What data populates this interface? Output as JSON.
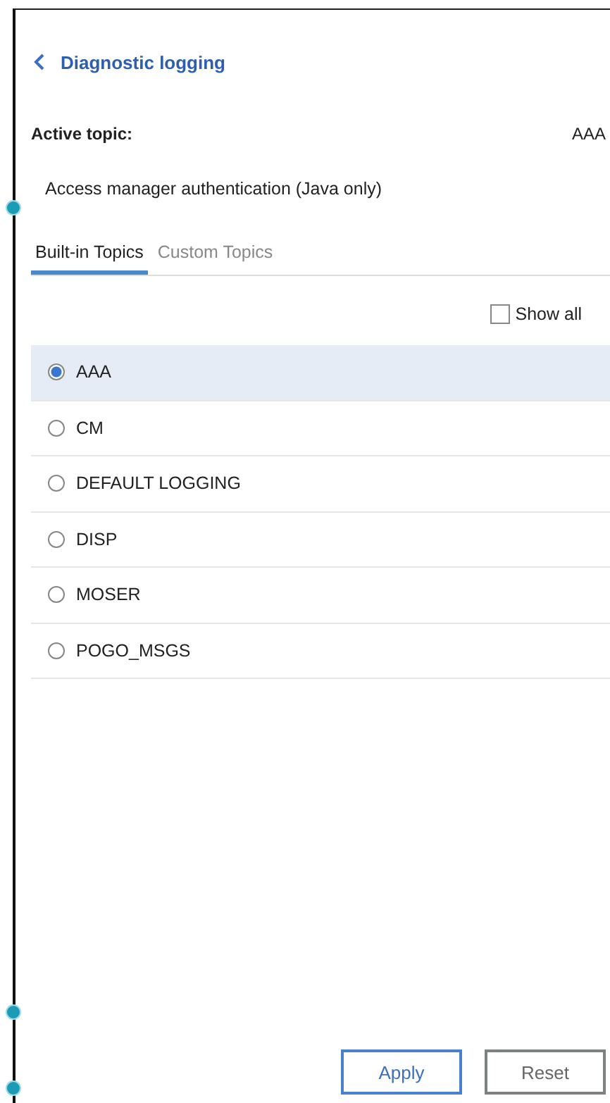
{
  "header": {
    "title": "Diagnostic logging"
  },
  "active_topic": {
    "label": "Active topic:",
    "value": "AAA",
    "description": "Access manager authentication (Java only)"
  },
  "tabs": [
    {
      "label": "Built-in Topics",
      "selected": true
    },
    {
      "label": "Custom Topics",
      "selected": false
    }
  ],
  "show_all": {
    "label": "Show all",
    "checked": false
  },
  "topics": [
    {
      "label": "AAA",
      "selected": true
    },
    {
      "label": "CM",
      "selected": false
    },
    {
      "label": "DEFAULT LOGGING",
      "selected": false
    },
    {
      "label": "DISP",
      "selected": false
    },
    {
      "label": "MOSER",
      "selected": false
    },
    {
      "label": "POGO_MSGS",
      "selected": false
    }
  ],
  "buttons": [
    {
      "label": "Apply",
      "kind": "primary"
    },
    {
      "label": "Reset",
      "kind": "secondary"
    }
  ]
}
